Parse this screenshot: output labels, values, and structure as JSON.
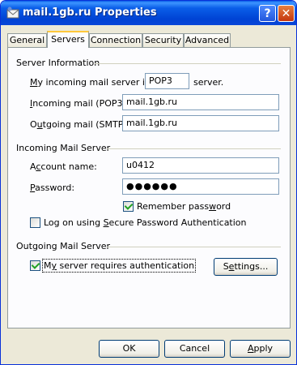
{
  "window": {
    "title": "mail.1gb.ru Properties",
    "help_label": "?",
    "close_label": "✕"
  },
  "tabs": [
    "General",
    "Servers",
    "Connection",
    "Security",
    "Advanced"
  ],
  "server_info": {
    "heading": "Server Information",
    "incoming_type_prefix": "y incoming mail server is a",
    "incoming_type_mnemonic": "M",
    "incoming_type_value": "POP3",
    "incoming_type_suffix": "server.",
    "incoming_label_mnemonic": "I",
    "incoming_label_rest": "ncoming mail (POP3):",
    "incoming_value": "mail.1gb.ru",
    "outgoing_label_pre": "O",
    "outgoing_label_mnemonic": "u",
    "outgoing_label_rest": "tgoing mail (SMTP):",
    "outgoing_value": "mail.1gb.ru"
  },
  "incoming_server": {
    "heading": "Incoming Mail Server",
    "account_label_pre": "A",
    "account_label_mnemonic": "c",
    "account_label_rest": "count name:",
    "account_value": "u0412",
    "password_label_mnemonic": "P",
    "password_label_rest": "assword:",
    "password_value": "●●●●●●",
    "remember_label_pre": "Remember pass",
    "remember_label_mnemonic": "w",
    "remember_label_rest": "ord",
    "spa_label_pre": "Log on using ",
    "spa_label_mnemonic": "S",
    "spa_label_rest": "ecure Password Authentication"
  },
  "outgoing_server": {
    "heading": "Outgoing Mail Server",
    "auth_label_pre": "M",
    "auth_label_mnemonic": "y",
    "auth_label_rest": " server requires authentication",
    "settings_pre": "S",
    "settings_mnemonic": "e",
    "settings_rest": "ttings..."
  },
  "buttons": {
    "ok": "OK",
    "cancel": "Cancel",
    "apply_mnemonic": "A",
    "apply_rest": "pply"
  },
  "state": {
    "remember_password": true,
    "spa": false,
    "auth_required": true,
    "active_tab": "Servers"
  },
  "colors": {
    "titlebar": "#0a5ee8",
    "face": "#ece9d8",
    "panel": "#fcfcfe",
    "tab_highlight": "#ffc83c",
    "check": "#21a121"
  }
}
